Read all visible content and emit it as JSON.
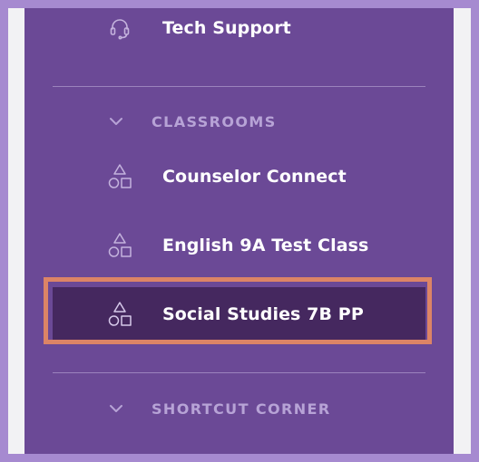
{
  "nav": {
    "tech_support": {
      "label": "Tech Support",
      "icon": "headset-icon"
    }
  },
  "classrooms": {
    "title": "CLASSROOMS",
    "icon": "chevron-down-icon",
    "items": [
      {
        "label": "Counselor Connect",
        "icon": "shapes-icon"
      },
      {
        "label": "English 9A Test Class",
        "icon": "shapes-icon"
      },
      {
        "label": "Social Studies 7B PP",
        "icon": "shapes-icon",
        "active": true
      }
    ]
  },
  "shortcut_corner": {
    "title": "SHORTCUT CORNER",
    "icon": "chevron-down-icon"
  },
  "colors": {
    "sidebar_bg": "#6b4996",
    "active_bg": "#45285f",
    "highlight_border": "#dc8466",
    "section_title": "#b7a3d6",
    "page_bg": "#a68ad0"
  }
}
